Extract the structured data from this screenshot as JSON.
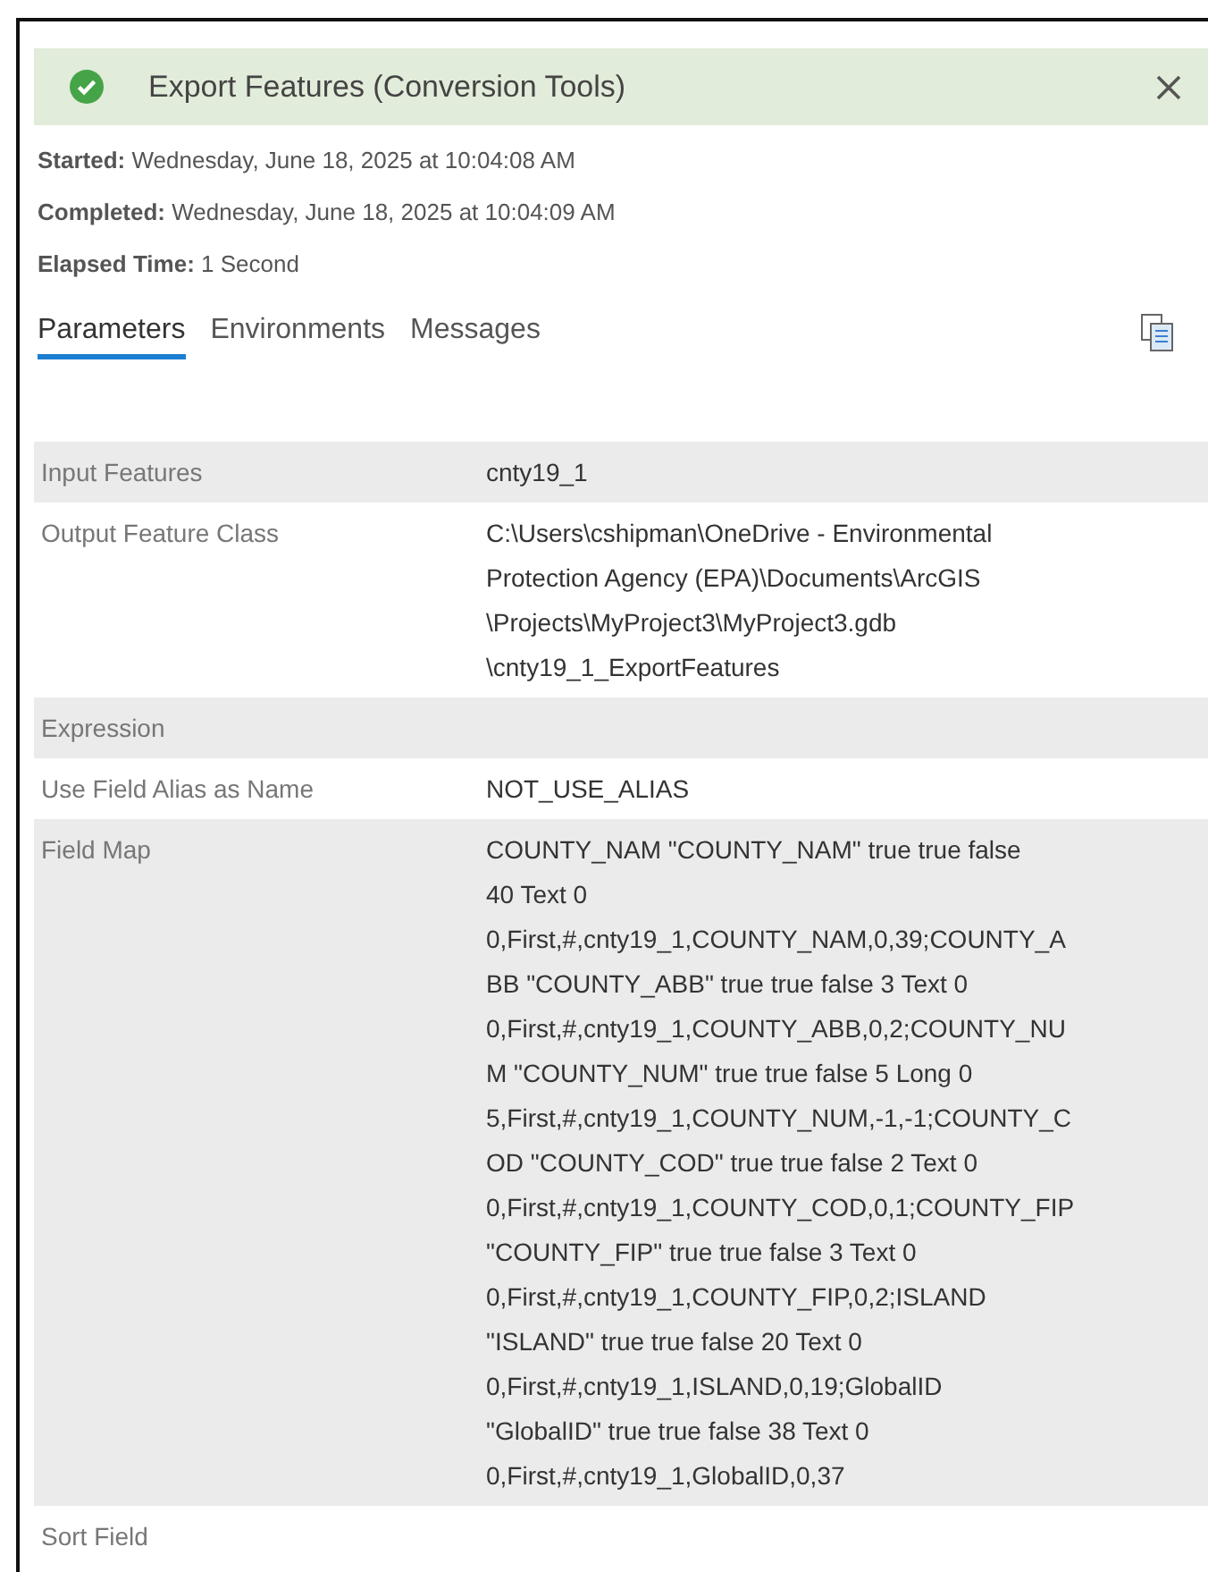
{
  "header": {
    "title": "Export Features (Conversion Tools)",
    "succeeded": true
  },
  "info": [
    {
      "label": "Started:",
      "value": "Wednesday, June 18, 2025 at 10:04:08 AM"
    },
    {
      "label": "Completed:",
      "value": "Wednesday, June 18, 2025 at 10:04:09 AM"
    },
    {
      "label": "Elapsed Time:",
      "value": "1 Second"
    }
  ],
  "tabs": [
    {
      "label": "Parameters",
      "selected": true
    },
    {
      "label": "Environments",
      "selected": false
    },
    {
      "label": "Messages",
      "selected": false
    }
  ],
  "parameters": [
    {
      "name": "Input Features",
      "value_lines": [
        "cnty19_1"
      ]
    },
    {
      "name": "Output Feature Class",
      "value_lines": [
        "C:\\Users\\cshipman\\OneDrive - Environmental",
        "Protection Agency (EPA)\\Documents\\ArcGIS",
        "\\Projects\\MyProject3\\MyProject3.gdb",
        "\\cnty19_1_ExportFeatures"
      ]
    },
    {
      "name": "Expression"
    },
    {
      "name": "Use Field Alias as Name",
      "value_lines": [
        "NOT_USE_ALIAS"
      ]
    },
    {
      "name": "Field Map",
      "value_lines": [
        "COUNTY_NAM \"COUNTY_NAM\" true true false",
        "40 Text 0",
        "0,First,#,cnty19_1,COUNTY_NAM,0,39;COUNTY_A",
        "BB \"COUNTY_ABB\" true true false 3 Text 0",
        "0,First,#,cnty19_1,COUNTY_ABB,0,2;COUNTY_NU",
        "M \"COUNTY_NUM\" true true false 5 Long 0",
        "5,First,#,cnty19_1,COUNTY_NUM,-1,-1;COUNTY_C",
        "OD \"COUNTY_COD\" true true false 2 Text 0",
        "0,First,#,cnty19_1,COUNTY_COD,0,1;COUNTY_FIP",
        "\"COUNTY_FIP\" true true false 3 Text 0",
        "0,First,#,cnty19_1,COUNTY_FIP,0,2;ISLAND",
        "\"ISLAND\" true true false 20 Text 0",
        "0,First,#,cnty19_1,ISLAND,0,19;GlobalID",
        "\"GlobalID\" true true false 38 Text 0",
        "0,First,#,cnty19_1,GlobalID,0,37"
      ]
    },
    {
      "name": "Sort Field"
    }
  ]
}
